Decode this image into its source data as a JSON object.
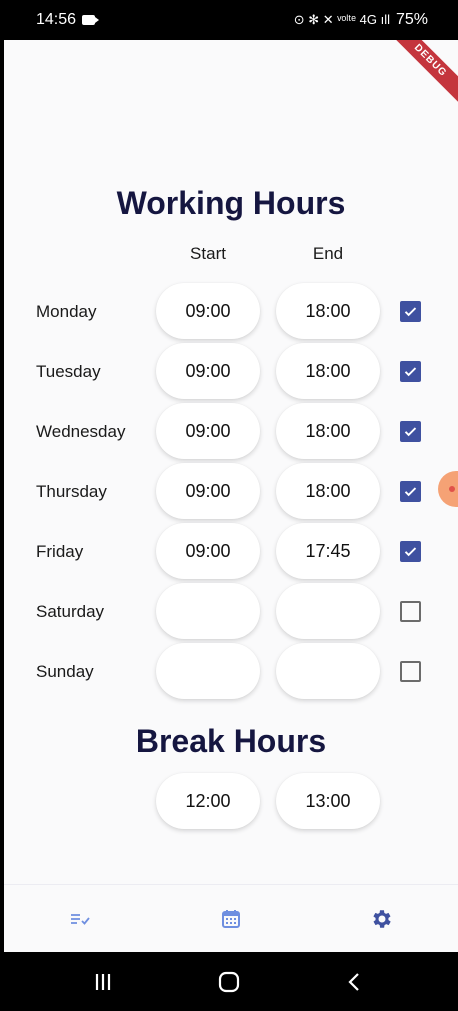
{
  "status_bar": {
    "time": "14:56",
    "indicators": "⊙ ✻ ✕ ᵛᵒˡᵗᵉ 4G ıll",
    "battery": "75%"
  },
  "debug_banner": "DEBUG",
  "working_hours": {
    "title": "Working Hours",
    "start_header": "Start",
    "end_header": "End",
    "days": [
      {
        "name": "Monday",
        "start": "09:00",
        "end": "18:00",
        "enabled": true
      },
      {
        "name": "Tuesday",
        "start": "09:00",
        "end": "18:00",
        "enabled": true
      },
      {
        "name": "Wednesday",
        "start": "09:00",
        "end": "18:00",
        "enabled": true
      },
      {
        "name": "Thursday",
        "start": "09:00",
        "end": "18:00",
        "enabled": true
      },
      {
        "name": "Friday",
        "start": "09:00",
        "end": "17:45",
        "enabled": true
      },
      {
        "name": "Saturday",
        "start": "",
        "end": "",
        "enabled": false
      },
      {
        "name": "Sunday",
        "start": "",
        "end": "",
        "enabled": false
      }
    ]
  },
  "break_hours": {
    "title": "Break Hours",
    "start": "12:00",
    "end": "13:00"
  },
  "bottom_nav": {
    "items": [
      {
        "icon": "checklist-icon",
        "color": "#6f8fe0"
      },
      {
        "icon": "calendar-icon",
        "color": "#6f8fe0"
      },
      {
        "icon": "settings-gear-icon",
        "color": "#3f51a0",
        "active": true
      }
    ]
  },
  "colors": {
    "accent": "#3f51a0",
    "title": "#151640",
    "background": "#fafafb"
  }
}
